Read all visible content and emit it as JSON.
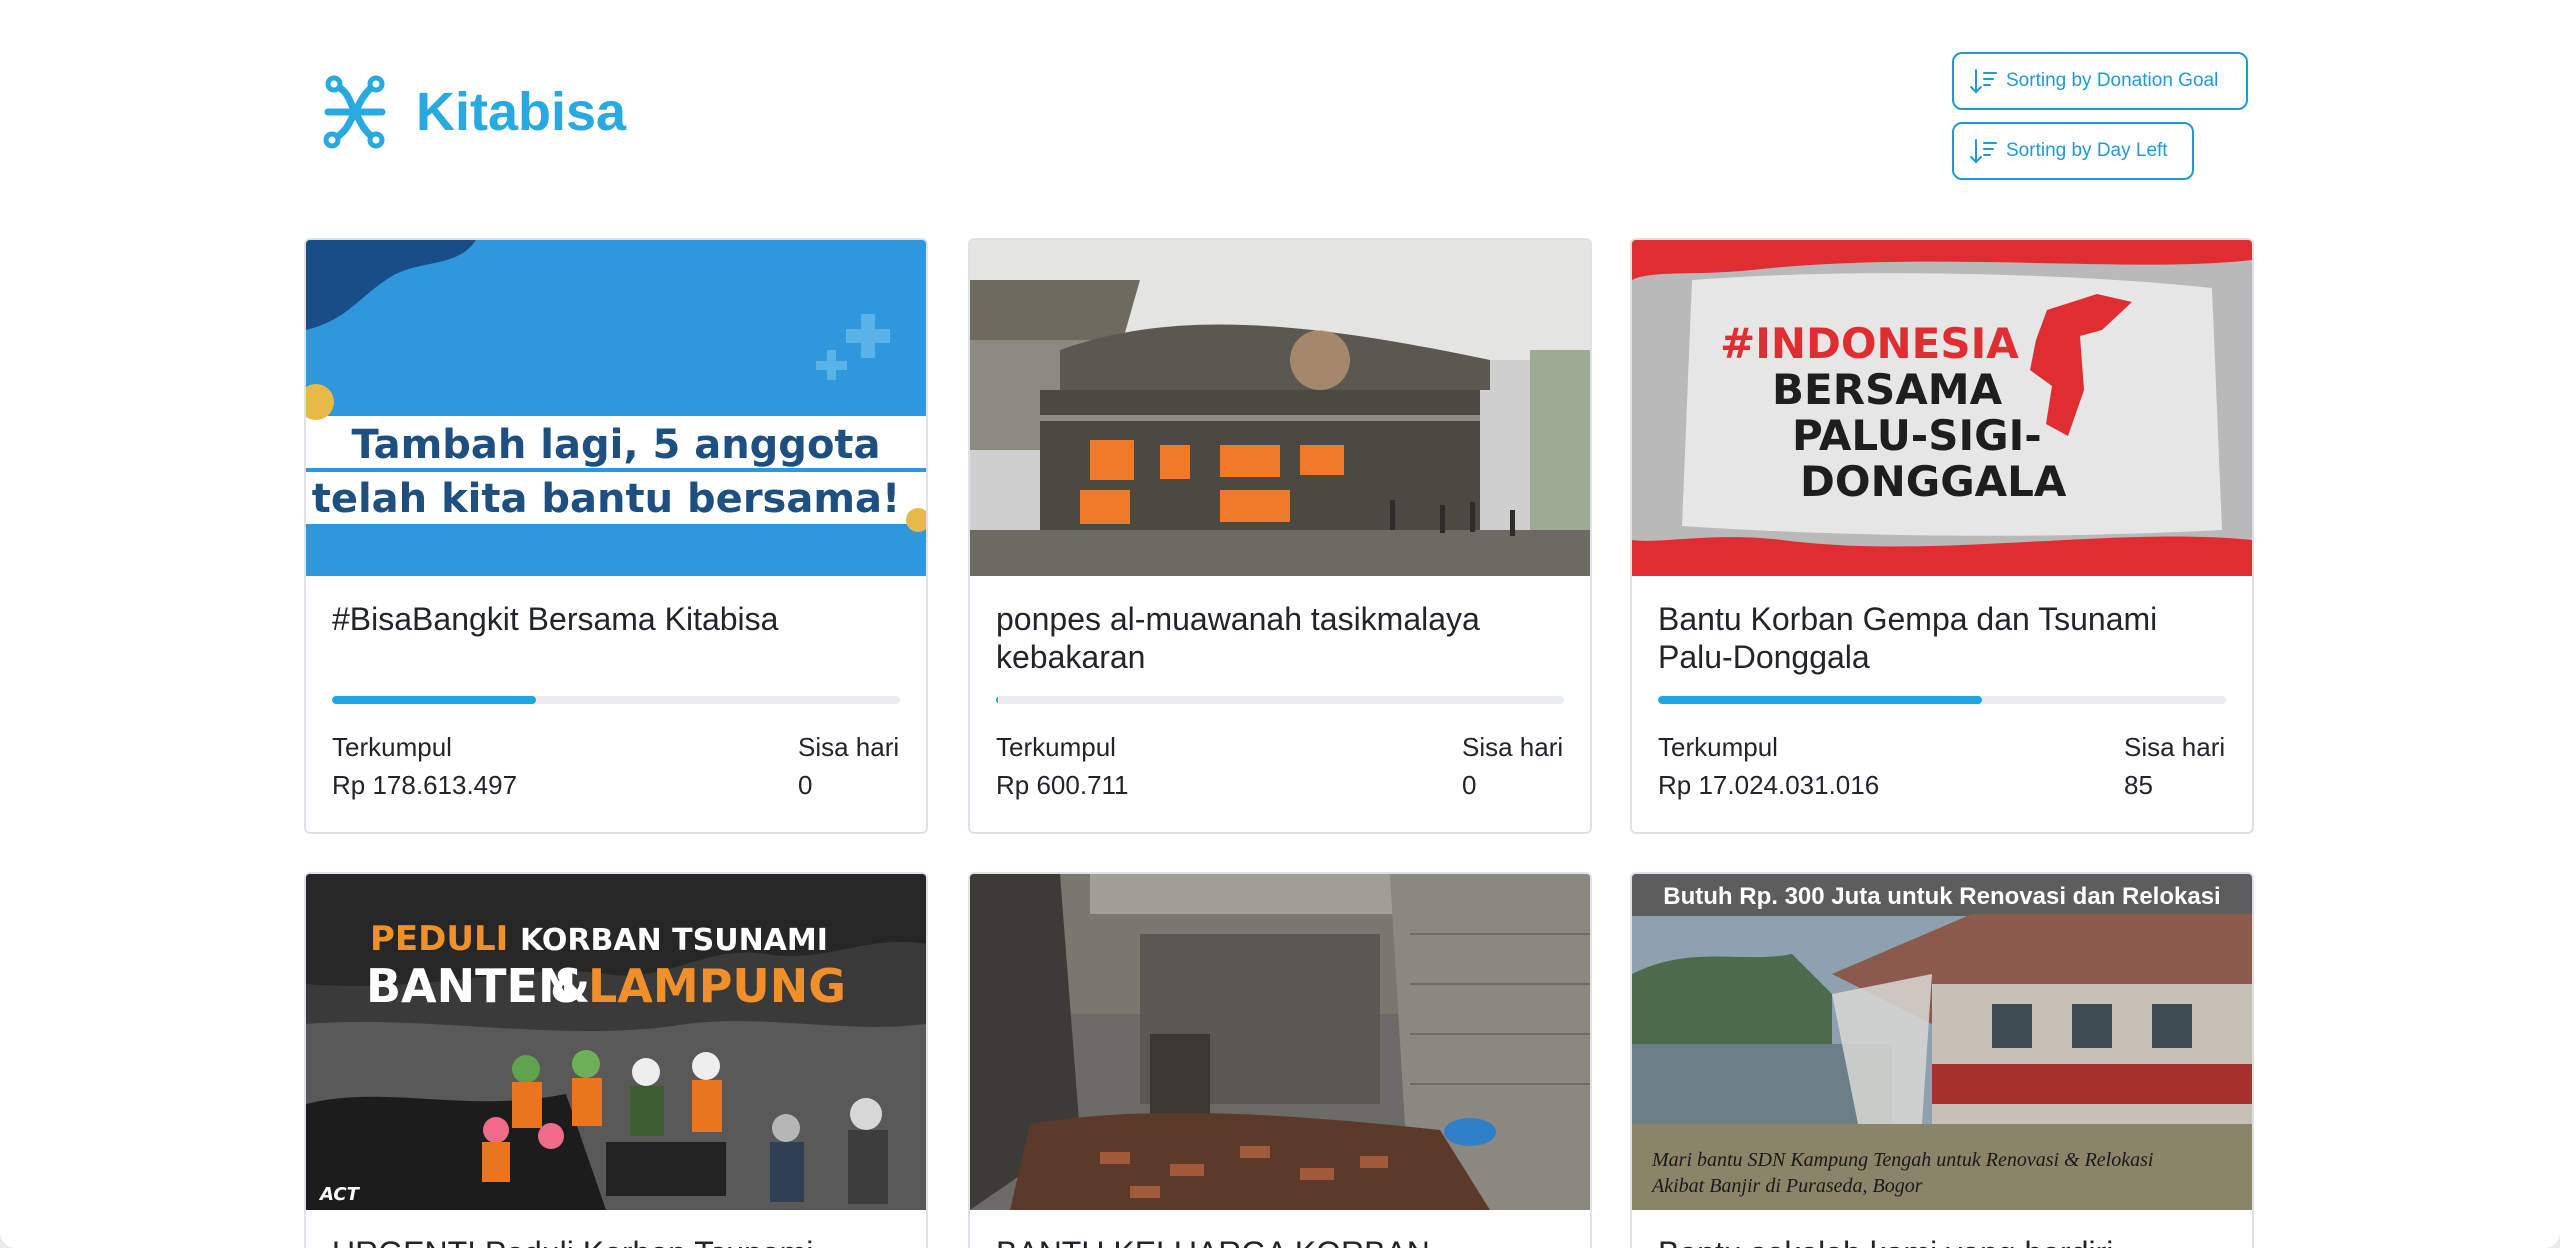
{
  "header": {
    "brand_name": "Kitabisa",
    "sort_donation_goal": "Sorting by Donation Goal",
    "sort_day_left": "Sorting by Day Left",
    "accent_color": "#27a9e1"
  },
  "labels": {
    "collected": "Terkumpul",
    "days_left": "Sisa hari"
  },
  "campaigns": [
    {
      "title": "#BisaBangkit Bersama Kitabisa",
      "collected": "Rp 178.613.497",
      "days_left": "0",
      "progress": 0.36,
      "image_text": [
        "Tambah lagi, 5 anggota",
        "telah kita bantu bersama!"
      ]
    },
    {
      "title": "ponpes al-muawanah tasikmalaya kebakaran",
      "collected": "Rp 600.711",
      "days_left": "0",
      "progress": 0.004
    },
    {
      "title": "Bantu Korban Gempa dan Tsunami Palu-Donggala",
      "collected": "Rp 17.024.031.016",
      "days_left": "85",
      "progress": 0.57,
      "image_text": [
        "#INDONESIA",
        "BERSAMA",
        "PALU-SIGI-",
        "DONGGALA"
      ]
    },
    {
      "title": "URGENT! Peduli Korban Tsunami",
      "image_text": [
        "PEDULI",
        "KORBAN TSUNAMI",
        "BANTEN",
        "&",
        "LAMPUNG",
        "ACT"
      ]
    },
    {
      "title": "BANTU KELUARGA KORBAN"
    },
    {
      "title": "Bantu sekolah kami yang berdiri",
      "image_text": [
        "Butuh Rp. 300 Juta untuk Renovasi dan Relokasi",
        "Mari bantu SDN Kampung Tengah untuk Renovasi & Relokasi",
        "Akibat Banjir di Puraseda, Bogor"
      ]
    }
  ]
}
